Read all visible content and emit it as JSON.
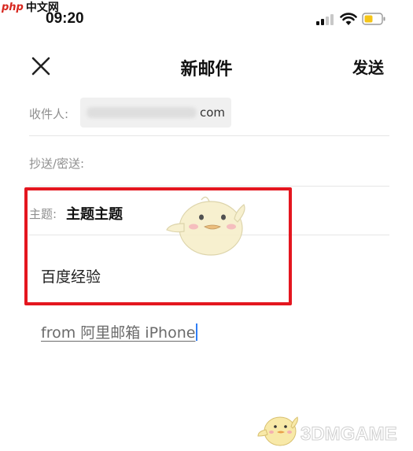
{
  "watermark_top": {
    "logo_latin": "php",
    "logo_cn": "中文网"
  },
  "status_bar": {
    "time": "09:20"
  },
  "nav": {
    "title": "新邮件",
    "send_label": "发送"
  },
  "compose": {
    "to_label": "收件人:",
    "to_value_suffix": "com",
    "cc_bcc_label": "抄送/密送:",
    "subject_label": "主题:",
    "subject_value": "主题主题",
    "body_text": "百度经验",
    "signature": "from 阿里邮箱 iPhone"
  },
  "watermark_bottom": {
    "text": "3DMGAME"
  },
  "colors": {
    "highlight": "#e4161f",
    "caret": "#2f7ef6",
    "battery": "#f5c518"
  }
}
